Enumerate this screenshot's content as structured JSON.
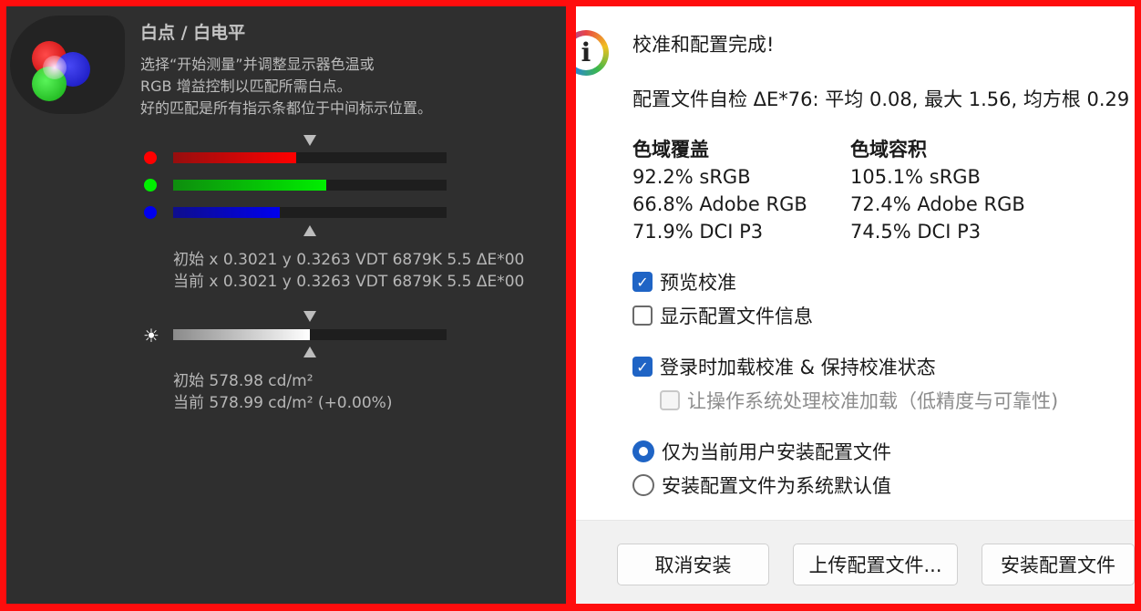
{
  "whitepoint": {
    "title": "白点 / 白电平",
    "desc": [
      "选择“开始测量”并调整显示器色温或",
      "RGB 增益控制以匹配所需白点。",
      "好的匹配是所有指示条都位于中间标示位置。"
    ],
    "bars": [
      {
        "name": "red",
        "color": "#ff0000",
        "fill": 0.45
      },
      {
        "name": "green",
        "color": "#00ee00",
        "fill": 0.56
      },
      {
        "name": "blue",
        "color": "#0000ee",
        "fill": 0.39
      }
    ],
    "initial": "初始 x 0.3021 y 0.3263 VDT 6879K 5.5 ΔE*00",
    "current": "当前 x 0.3021 y 0.3263 VDT 6879K 5.5 ΔE*00",
    "luminance_fill": 0.5,
    "lum_initial": "初始 578.98 cd/m²",
    "lum_current": "当前 578.99 cd/m² (+0.00%)"
  },
  "dialog": {
    "heading": "校准和配置完成!",
    "selfcheck": "配置文件自检 ΔE*76: 平均 0.08, 最大 1.56, 均方根 0.29",
    "coverage": {
      "header": "色域覆盖",
      "rows": [
        "92.2% sRGB",
        "66.8% Adobe RGB",
        "71.9% DCI P3"
      ]
    },
    "volume": {
      "header": "色域容积",
      "rows": [
        "105.1% sRGB",
        "72.4% Adobe RGB",
        "74.5% DCI P3"
      ]
    },
    "options": {
      "preview": "预览校准",
      "show_info": "显示配置文件信息",
      "load_on_login": "登录时加载校准 & 保持校准状态",
      "let_os": "让操作系统处理校准加载（低精度与可靠性)",
      "current_user": "仅为当前用户安装配置文件",
      "system_default": "安装配置文件为系统默认值"
    },
    "buttons": {
      "cancel": "取消安装",
      "upload": "上传配置文件...",
      "install": "安装配置文件"
    }
  }
}
